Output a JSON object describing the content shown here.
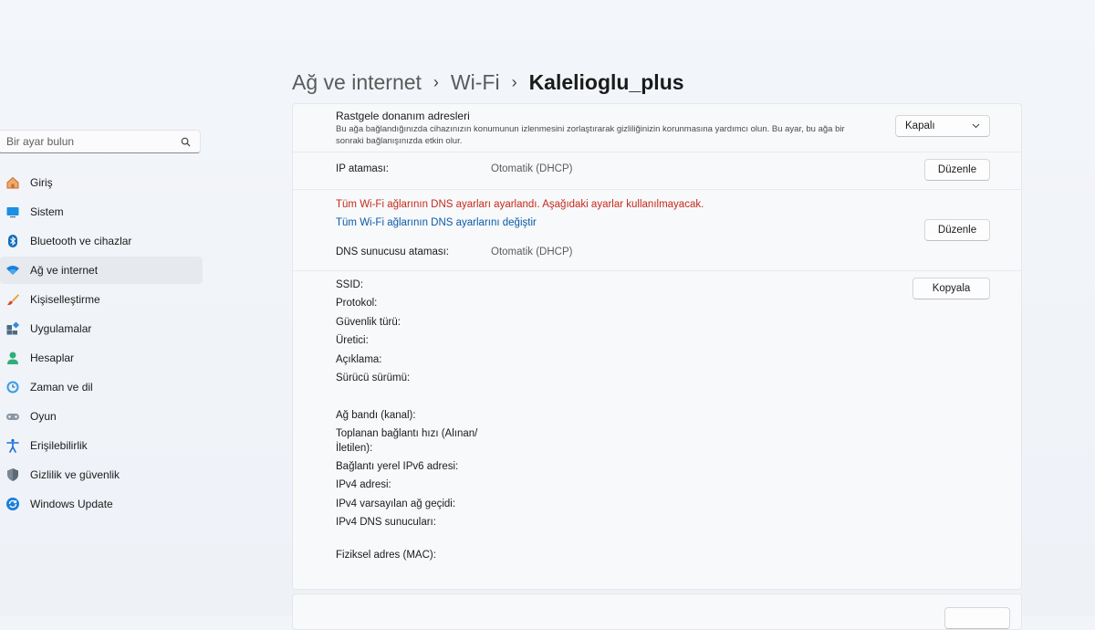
{
  "breadcrumb": [
    "Ağ ve internet",
    "Wi-Fi",
    "Kalelioglu_plus"
  ],
  "search": {
    "placeholder": "Bir ayar bulun"
  },
  "sidebar": {
    "items": [
      {
        "label": "Giriş",
        "icon": "home-icon"
      },
      {
        "label": "Sistem",
        "icon": "system-icon"
      },
      {
        "label": "Bluetooth ve cihazlar",
        "icon": "bluetooth-icon"
      },
      {
        "label": "Ağ ve internet",
        "icon": "wifi-icon",
        "active": true
      },
      {
        "label": "Kişiselleştirme",
        "icon": "brush-icon"
      },
      {
        "label": "Uygulamalar",
        "icon": "apps-icon"
      },
      {
        "label": "Hesaplar",
        "icon": "account-icon"
      },
      {
        "label": "Zaman ve dil",
        "icon": "clock-icon"
      },
      {
        "label": "Oyun",
        "icon": "gamepad-icon"
      },
      {
        "label": "Erişilebilirlik",
        "icon": "accessibility-icon"
      },
      {
        "label": "Gizlilik ve güvenlik",
        "icon": "shield-icon"
      },
      {
        "label": "Windows Update",
        "icon": "update-icon"
      }
    ]
  },
  "random_hw": {
    "title": "Rastgele donanım adresleri",
    "description": "Bu ağa bağlandığınızda cihazınızın konumunun izlenmesini zorlaştırarak gizliliğinizin korunmasına yardımcı olun. Bu ayar, bu ağa bir sonraki bağlanışınızda etkin olur.",
    "value": "Kapalı"
  },
  "ip": {
    "label": "IP ataması:",
    "value": "Otomatik (DHCP)",
    "button": "Düzenle"
  },
  "dns": {
    "warning": "Tüm Wi-Fi ağlarının DNS ayarları ayarlandı. Aşağıdaki ayarlar kullanılmayacak.",
    "link": "Tüm Wi-Fi ağlarının DNS ayarlarını değiştir",
    "label": "DNS sunucusu ataması:",
    "value": "Otomatik (DHCP)",
    "button": "Düzenle"
  },
  "properties": {
    "copy_button": "Kopyala",
    "ssid": "SSID:",
    "protocol": "Protokol:",
    "security": "Güvenlik türü:",
    "manufacturer": "Üretici:",
    "description": "Açıklama:",
    "driver": "Sürücü sürümü:",
    "band": "Ağ bandı (kanal):",
    "speed_1": "Toplanan bağlantı hızı (Alınan/",
    "speed_2": "İletilen):",
    "ipv6": "Bağlantı yerel IPv6 adresi:",
    "ipv4": "IPv4 adresi:",
    "gateway": "IPv4 varsayılan ağ geçidi:",
    "ipv4_dns": "IPv4 DNS sunucuları:",
    "mac": "Fiziksel adres (MAC):"
  },
  "colors": {
    "accent": "#0067c0",
    "warning": "#c42b1c",
    "link": "#0a5aa8"
  }
}
